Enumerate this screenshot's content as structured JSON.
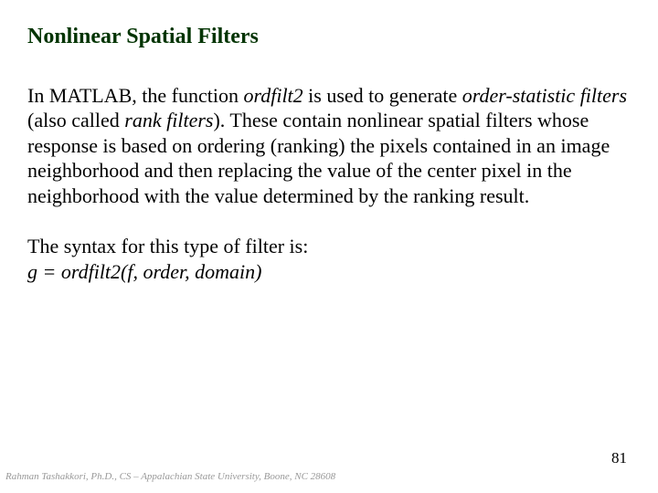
{
  "title": "Nonlinear Spatial Filters",
  "p1_a": "In MATLAB, the function ",
  "p1_i1": "ordfilt2",
  "p1_b": " is used to generate ",
  "p1_i2": "order-statistic filters",
  "p1_c": " (also called ",
  "p1_i3": "rank filters",
  "p1_d": ").   These contain nonlinear spatial filters whose response is based on ordering (ranking) the pixels contained in an image neighborhood and then replacing the value of the center pixel in the neighborhood with the value determined by the ranking result.",
  "p2_a": "The syntax for this type of filter is:",
  "p2_b": "g = ordfilt2(f, order, domain)",
  "footer": "Rahman Tashakkori, Ph.D., CS – Appalachian State University, Boone, NC 28608",
  "pagenum": "81"
}
